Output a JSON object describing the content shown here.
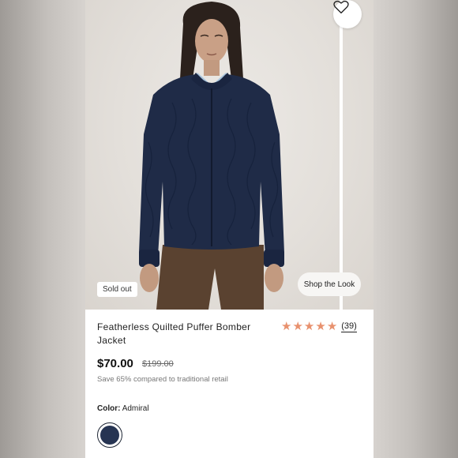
{
  "product": {
    "image_alt": "Woman wearing navy quilted bomber jacket",
    "sold_out_label": "Sold out",
    "shop_the_look_label": "Shop the Look",
    "wishlist_icon": "heart-icon",
    "title": "Featherless Quilted Puffer Bomber Jacket",
    "rating_stars": 5,
    "rating_max": 5,
    "review_count_label": "(39)",
    "price": "$70.00",
    "original_price": "$199.00",
    "savings_text": "Save 65% compared to traditional retail",
    "color_label": "Color:",
    "color_value": "Admiral",
    "swatch_color": "#263452",
    "star_color": "#e8916e"
  }
}
